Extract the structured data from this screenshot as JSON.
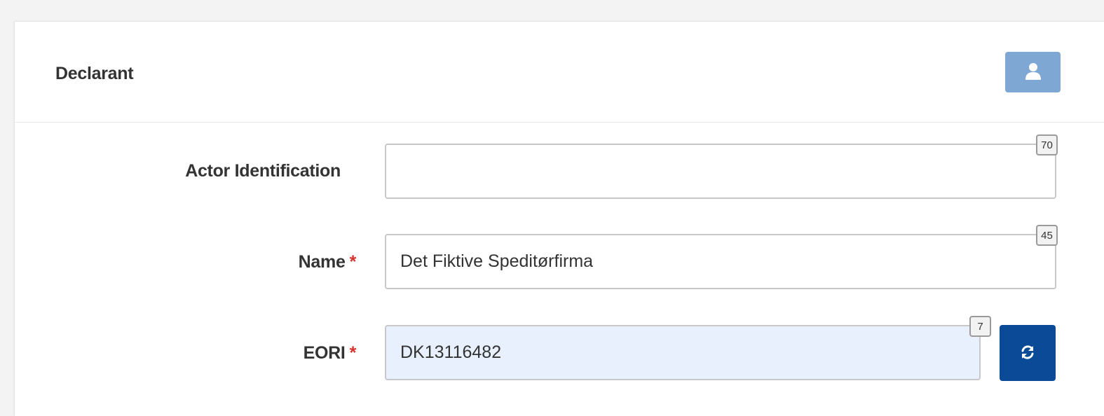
{
  "declarant": {
    "title": "Declarant",
    "header_button_icon": "user-icon",
    "fields": {
      "actor_identification": {
        "label": "Actor Identification",
        "value": "",
        "max_length": "70"
      },
      "name": {
        "label": "Name",
        "required_mark": "*",
        "value": "Det Fiktive Speditørfirma",
        "max_length": "45"
      },
      "eori": {
        "label": "EORI",
        "required_mark": "*",
        "value": "DK13116482",
        "max_length": "7",
        "refresh_button_icon": "refresh-icon"
      }
    }
  },
  "colors": {
    "header_button": "#7fa7d3",
    "refresh_button": "#0b4a97",
    "eori_field_background": "#e8f0fe",
    "required_mark": "#d9302c"
  }
}
